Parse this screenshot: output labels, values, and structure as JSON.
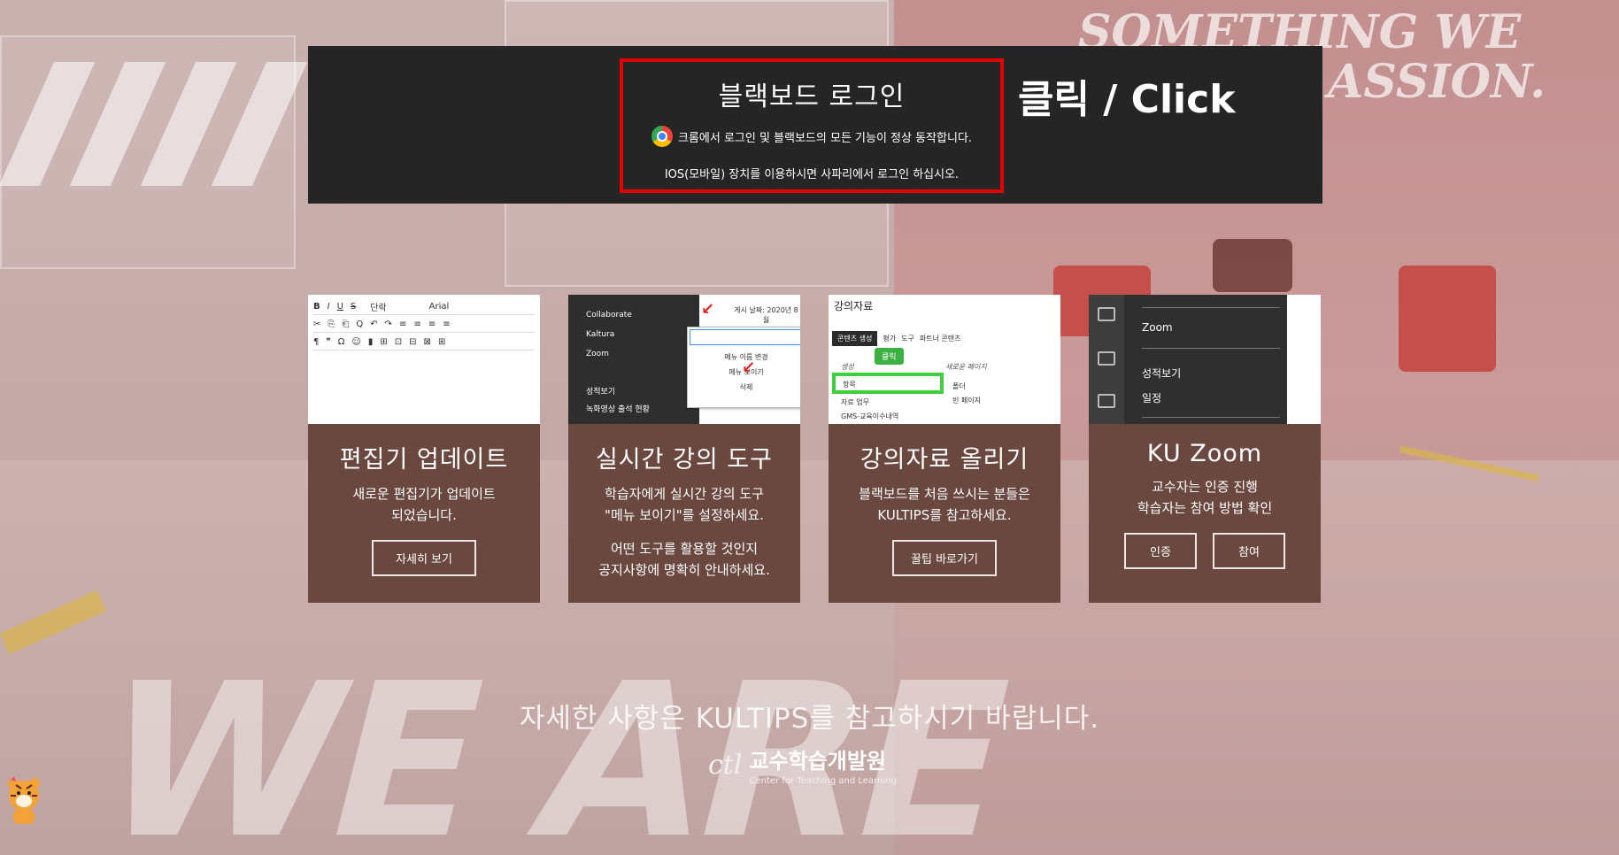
{
  "login": {
    "title": "블랙보드 로그인",
    "line1": "크롬에서 로그인 및 블랙보드의 모든 기능이 정상 동작합니다.",
    "line2": "IOS(모바일) 장치를 이용하시면 사파리에서 로그인 하십시오.",
    "click_label": "클릭 / Click"
  },
  "background": {
    "wall_top": "SOMETHING WE LOVE",
    "wall_passion": "ASSION.",
    "floor_big": "WE ARE"
  },
  "cards": [
    {
      "title": "편집기 업데이트",
      "desc_lines": [
        "새로운 편집기가 업데이트",
        "되었습니다."
      ],
      "buttons": [
        "자세히 보기"
      ],
      "img": {
        "toolbar1": [
          "B",
          "I",
          "U",
          "S",
          "단락",
          "Arial"
        ],
        "toolbar2": [
          "✂",
          "⎘",
          "⎗",
          "Q",
          "↶",
          "↷",
          "≡",
          "≡",
          "≡",
          "≡"
        ],
        "toolbar3": [
          "¶",
          "❞",
          "Ω",
          "☺",
          "▮",
          "⊞",
          "⊡",
          "⊟",
          "⊠",
          "⊞"
        ]
      }
    },
    {
      "title": "실시간 강의 도구",
      "desc_lines": [
        "학습자에게 실시간 강의 도구",
        "\"메뉴 보이기\"를 설정하세요.",
        "",
        "어떤 도구를 활용할 것인지",
        "공지사항에 명확히 안내하세요."
      ],
      "buttons": [],
      "img": {
        "menu": [
          "Collaborate",
          "Kaltura",
          "Zoom",
          "성적보기",
          "녹화영상 출석 현황"
        ],
        "ctx": [
          "메뉴 이름 변경",
          "메뉴 보이기",
          "삭제"
        ],
        "post_date": "게시 날짜: 2020년 8월"
      }
    },
    {
      "title": "강의자료 올리기",
      "desc_lines": [
        "블랙보드를 처음 쓰시는 분들은",
        "KULTIPS를 참고하세요."
      ],
      "buttons": [
        "꿀팁 바로가기"
      ],
      "img": {
        "head": "강의자료",
        "tabs": [
          "콘텐츠 생성",
          "평가",
          "도구",
          "파트너 콘텐츠"
        ],
        "pill": "클릭",
        "items": [
          "생성",
          "항목",
          "자료 업무",
          "GMS-교육이수내역"
        ],
        "right_items": [
          "새로운 페이지",
          "폴더",
          "빈 페이지"
        ]
      }
    },
    {
      "title": "KU Zoom",
      "desc_lines": [
        "교수자는 인증 진행",
        "학습자는 참여 방법 확인"
      ],
      "buttons": [
        "인증",
        "참여"
      ],
      "img": {
        "items": [
          "Zoom",
          "성적보기",
          "일정"
        ]
      }
    }
  ],
  "footer": {
    "notice": "자세한 사항은 KULTIPS를 참고하시기 바랍니다.",
    "logo_mark": "ctl",
    "logo_kr": "교수학습개발원",
    "logo_en": "Center for Teaching and Learning"
  }
}
